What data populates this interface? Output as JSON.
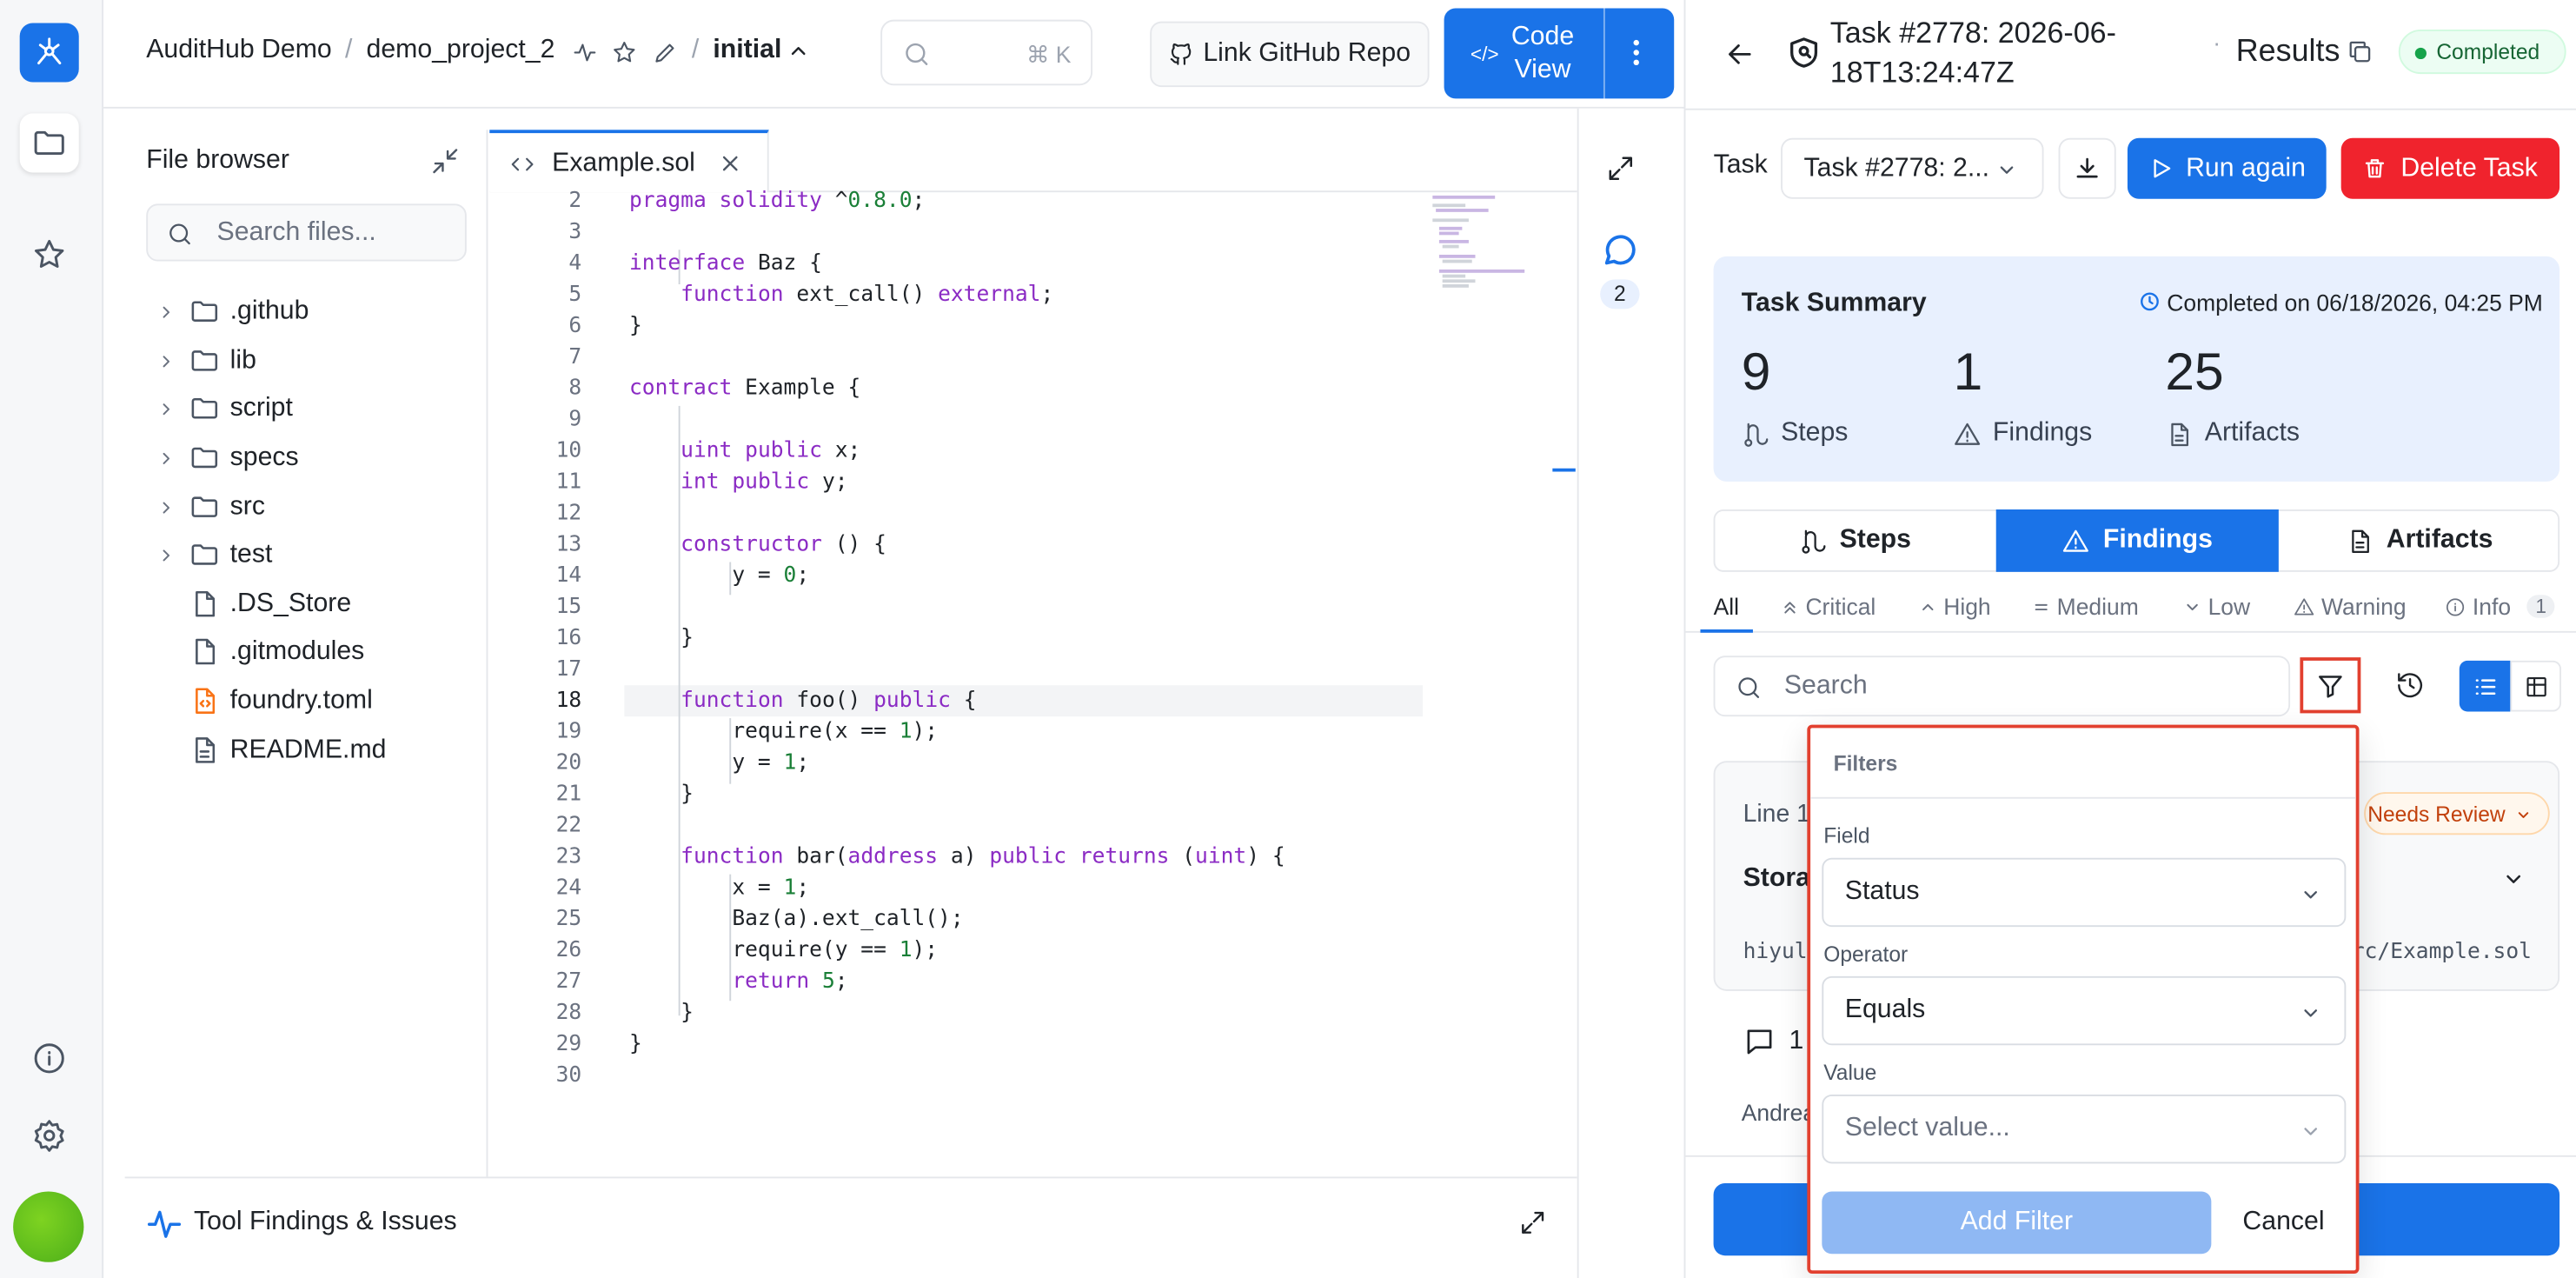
{
  "header": {
    "org": "AuditHub Demo",
    "sep1": "/",
    "project": "demo_project_2",
    "sep2": "/",
    "version": "initial",
    "search_shortcut": "⌘ K",
    "link_github": "Link GitHub Repo",
    "code_view": "Code View"
  },
  "file_browser": {
    "title": "File browser",
    "search_placeholder": "Search files...",
    "folders": [
      ".github",
      "lib",
      "script",
      "specs",
      "src",
      "test"
    ],
    "files": [
      ".DS_Store",
      ".gitmodules",
      "foundry.toml",
      "README.md"
    ]
  },
  "editor": {
    "tab_name": "Example.sol",
    "active_line": 18,
    "line_numbers": [
      "2",
      "3",
      "4",
      "5",
      "6",
      "7",
      "8",
      "9",
      "10",
      "11",
      "12",
      "13",
      "14",
      "15",
      "16",
      "17",
      "18",
      "19",
      "20",
      "21",
      "22",
      "23",
      "24",
      "25",
      "26",
      "27",
      "28",
      "29",
      "30"
    ],
    "comment_count": "2"
  },
  "bottom_panel": {
    "title": "Tool Findings & Issues"
  },
  "task": {
    "title": "Task #2778: 2026-06-18T13:24:47Z",
    "results": "Results",
    "status": "Completed",
    "task_label": "Task",
    "task_select": "Task #2778: 2...",
    "run_again": "Run again",
    "delete": "Delete Task"
  },
  "summary": {
    "title": "Task Summary",
    "completed_on": "Completed on 06/18/2026, 04:25 PM",
    "steps_value": "9",
    "steps_label": "Steps",
    "findings_value": "1",
    "findings_label": "Findings",
    "artifacts_value": "25",
    "artifacts_label": "Artifacts"
  },
  "tabs": {
    "steps": "Steps",
    "findings": "Findings",
    "artifacts": "Artifacts"
  },
  "severity": {
    "all": "All",
    "critical": "Critical",
    "high": "High",
    "medium": "Medium",
    "low": "Low",
    "warning": "Warning",
    "info": "Info",
    "info_count": "1"
  },
  "findings_search_placeholder": "Search",
  "finding_card": {
    "line_prefix": "Line 1",
    "needs_review": "Needs Review",
    "title_prefix": "Stora",
    "path_left": "hiyul/u",
    "path_right": "rc/Example.sol",
    "comment_count": "1",
    "author": "Andrea"
  },
  "filters": {
    "title": "Filters",
    "field_label": "Field",
    "field_value": "Status",
    "operator_label": "Operator",
    "operator_value": "Equals",
    "value_label": "Value",
    "value_placeholder": "Select value...",
    "add_filter": "Add Filter",
    "cancel": "Cancel"
  },
  "colors": {
    "accent": "#1a73e8",
    "danger": "#f0232d",
    "success": "#16a34a",
    "highlight_border": "#e2402f"
  }
}
